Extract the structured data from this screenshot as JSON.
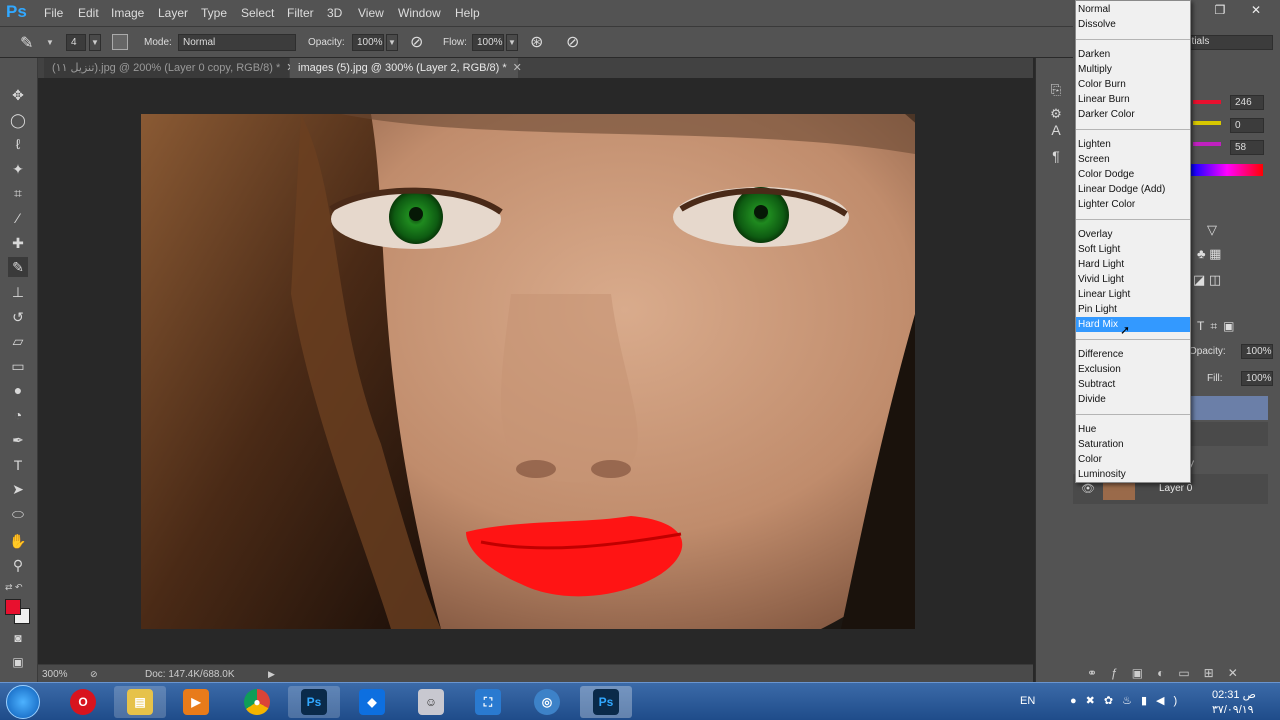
{
  "app": {
    "logo": "Ps"
  },
  "menu": [
    "File",
    "Edit",
    "Image",
    "Layer",
    "Type",
    "Select",
    "Filter",
    "3D",
    "View",
    "Window",
    "Help"
  ],
  "window_controls": {
    "minimize": "—",
    "restore": "❐",
    "close": "✕"
  },
  "options": {
    "brush_size": "4",
    "mode_label": "Mode:",
    "mode_value": "Normal",
    "opacity_label": "Opacity:",
    "opacity_value": "100%",
    "flow_label": "Flow:",
    "flow_value": "100%"
  },
  "tabs": [
    {
      "label": "(تنزيل ١١).jpg @ 200% (Layer 0 copy, RGB/8) *",
      "active": false
    },
    {
      "label": "images (5).jpg @ 300% (Layer 2, RGB/8) *",
      "active": true
    }
  ],
  "status": {
    "zoom": "300%",
    "doc": "Doc: 147.4K/688.0K"
  },
  "panels": {
    "workspace_partial": "ntials",
    "color_values": [
      "246",
      "0",
      "58"
    ],
    "opacity_label": "Opacity:",
    "opacity_value": "100%",
    "fill_label": "Fill:",
    "fill_value": "100%",
    "layer_partial": "y",
    "layer_name": "Layer 0"
  },
  "blend_modes": {
    "groups": [
      [
        "Normal",
        "Dissolve"
      ],
      [
        "Darken",
        "Multiply",
        "Color Burn",
        "Linear Burn",
        "Darker Color"
      ],
      [
        "Lighten",
        "Screen",
        "Color Dodge",
        "Linear Dodge (Add)",
        "Lighter Color"
      ],
      [
        "Overlay",
        "Soft Light",
        "Hard Light",
        "Vivid Light",
        "Linear Light",
        "Pin Light",
        "Hard Mix"
      ],
      [
        "Difference",
        "Exclusion",
        "Subtract",
        "Divide"
      ],
      [
        "Hue",
        "Saturation",
        "Color",
        "Luminosity"
      ]
    ],
    "selected": "Hard Mix"
  },
  "taskbar": {
    "lang": "EN",
    "time": "02:31 ص",
    "date": "٣٧/٠٩/١٩"
  },
  "colors": {
    "foreground": "#e8102e",
    "background": "#f0f0f0",
    "selection": "#3399ff",
    "brand": "#31a8ff"
  }
}
